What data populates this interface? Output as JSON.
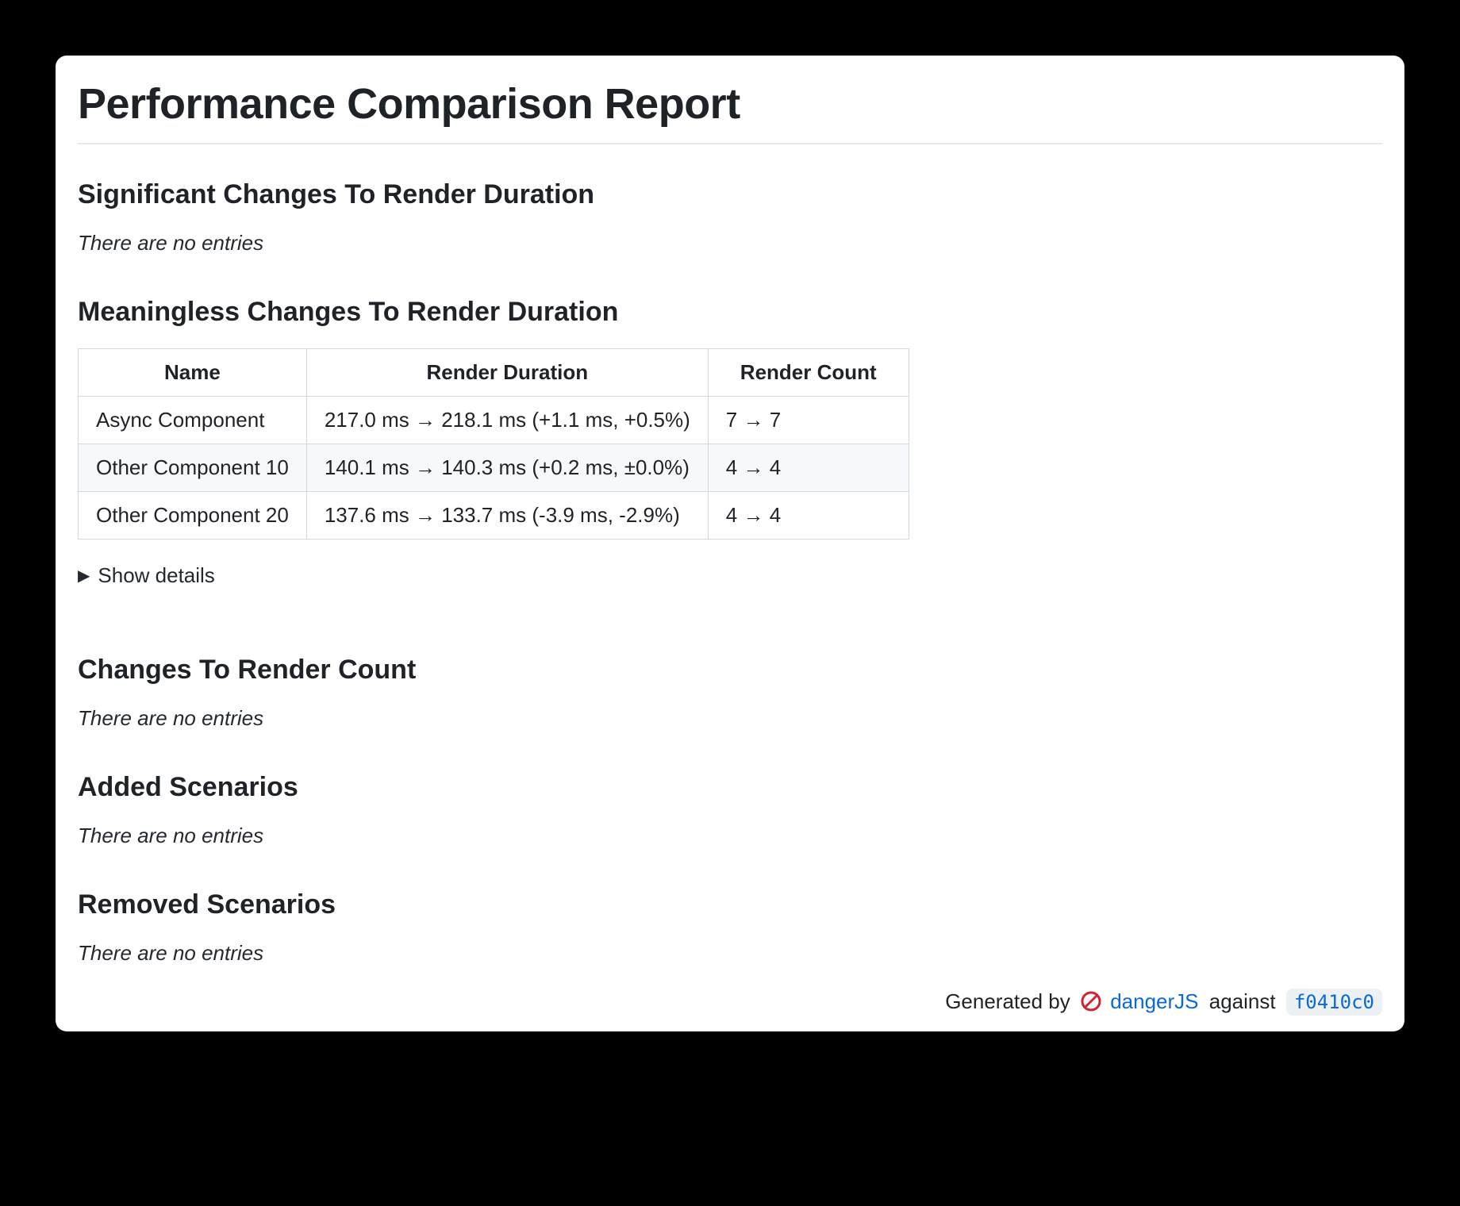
{
  "title": "Performance Comparison Report",
  "sections": {
    "significant": {
      "heading": "Significant Changes To Render Duration",
      "empty": "There are no entries"
    },
    "meaningless": {
      "heading": "Meaningless Changes To Render Duration",
      "columns": {
        "name": "Name",
        "duration": "Render Duration",
        "count": "Render Count"
      },
      "rows": [
        {
          "name": "Async Component",
          "duration": "217.0 ms → 218.1 ms (+1.1 ms, +0.5%)",
          "count": "7 → 7"
        },
        {
          "name": "Other Component 10",
          "duration": "140.1 ms → 140.3 ms (+0.2 ms, ±0.0%)",
          "count": "4 → 4"
        },
        {
          "name": "Other Component 20",
          "duration": "137.6 ms → 133.7 ms (-3.9 ms, -2.9%)",
          "count": "4 → 4"
        }
      ],
      "show_details": "Show details"
    },
    "render_count": {
      "heading": "Changes To Render Count",
      "empty": "There are no entries"
    },
    "added": {
      "heading": "Added Scenarios",
      "empty": "There are no entries"
    },
    "removed": {
      "heading": "Removed Scenarios",
      "empty": "There are no entries"
    }
  },
  "footer": {
    "generated_by": "Generated by",
    "tool": "dangerJS",
    "against": "against",
    "commit": "f0410c0"
  }
}
